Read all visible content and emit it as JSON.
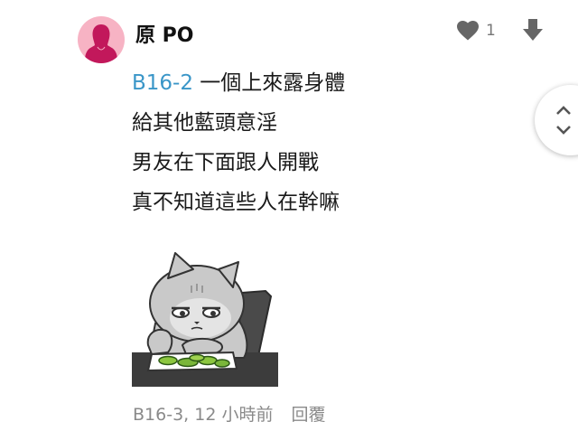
{
  "post": {
    "author": "原 PO",
    "like_count": "1",
    "reference": "B16-2",
    "lines": [
      "一個上來露身體",
      "給其他藍頭意淫",
      "男友在下面跟人開戰",
      "真不知道這些人在幹嘛"
    ],
    "meta": "B16-3, 12 小時前",
    "reply_label": "回覆"
  },
  "icons": {
    "like": "heart-icon",
    "downvote": "arrow-down-icon",
    "scroll": "chevron-up-down-icon"
  },
  "colors": {
    "avatar_bg": "#f7b3c4",
    "avatar_fg": "#c2185b",
    "link": "#3a96c8",
    "meta": "#8a8a8a",
    "icon": "#666666"
  }
}
